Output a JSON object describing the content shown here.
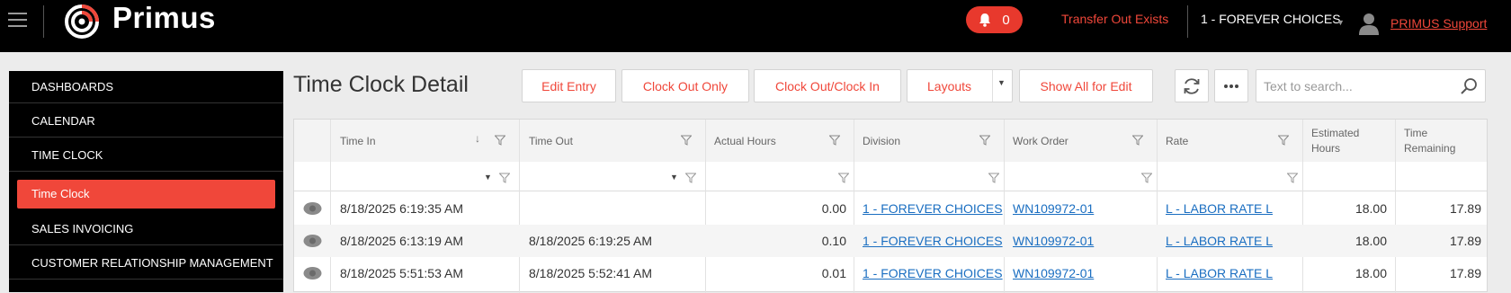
{
  "app": {
    "brand": "Primus",
    "notification_count": "0",
    "transfer_notice": "Transfer Out Exists",
    "company": "1 - FOREVER CHOICES",
    "support_link": "PRIMUS Support"
  },
  "sidebar": {
    "items": [
      {
        "label": "DASHBOARDS"
      },
      {
        "label": "CALENDAR"
      },
      {
        "label": "TIME CLOCK"
      },
      {
        "label": "Time Clock",
        "active": true
      },
      {
        "label": "SALES INVOICING"
      },
      {
        "label": "CUSTOMER RELATIONSHIP MANAGEMENT"
      }
    ]
  },
  "page": {
    "title": "Time Clock Detail"
  },
  "toolbar": {
    "edit_entry": "Edit Entry",
    "clock_out_only": "Clock Out Only",
    "clock_out_in": "Clock Out/Clock In",
    "layouts": "Layouts",
    "show_all": "Show All for Edit",
    "search_placeholder": "Text to search..."
  },
  "table": {
    "columns": {
      "time_in": "Time In",
      "time_out": "Time Out",
      "actual_hours": "Actual Hours",
      "division": "Division",
      "work_order": "Work Order",
      "rate": "Rate",
      "estimated_hours_1": "Estimated",
      "estimated_hours_2": "Hours",
      "time_remaining_1": "Time",
      "time_remaining_2": "Remaining"
    },
    "rows": [
      {
        "time_in": "8/18/2025 6:19:35 AM",
        "time_out": "",
        "actual_hours": "0.00",
        "division": "1 - FOREVER CHOICES",
        "work_order": "WN109972-01",
        "rate": "L - LABOR RATE L",
        "estimated_hours": "18.00",
        "time_remaining": "17.89"
      },
      {
        "time_in": "8/18/2025 6:13:19 AM",
        "time_out": "8/18/2025 6:19:25 AM",
        "actual_hours": "0.10",
        "division": "1 - FOREVER CHOICES",
        "work_order": "WN109972-01",
        "rate": "L - LABOR RATE L",
        "estimated_hours": "18.00",
        "time_remaining": "17.89"
      },
      {
        "time_in": "8/18/2025 5:51:53 AM",
        "time_out": "8/18/2025 5:52:41 AM",
        "actual_hours": "0.01",
        "division": "1 - FOREVER CHOICES",
        "work_order": "WN109972-01",
        "rate": "L - LABOR RATE L",
        "estimated_hours": "18.00",
        "time_remaining": "17.89"
      }
    ]
  },
  "colors": {
    "accent": "#f0473a",
    "link": "#1a6ec1",
    "topbar": "#000000"
  }
}
